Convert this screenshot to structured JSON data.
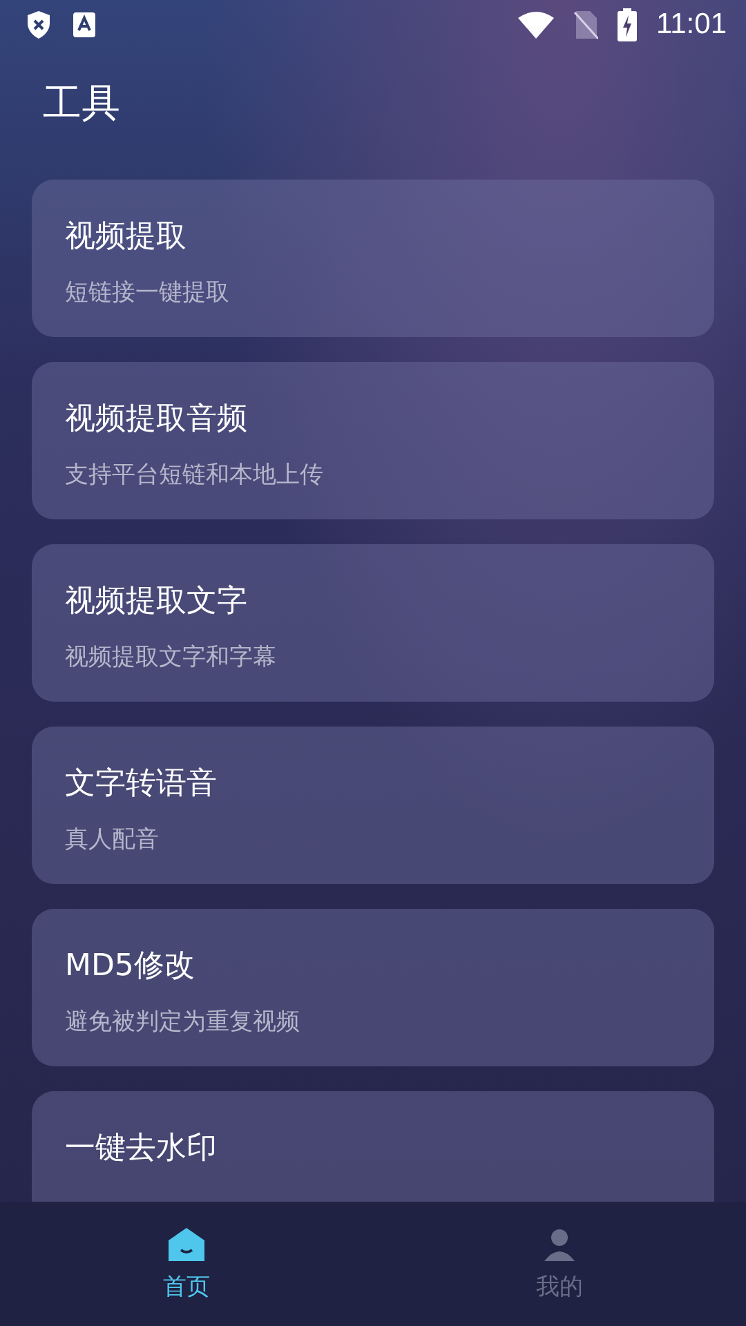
{
  "status_bar": {
    "time": "11:01"
  },
  "title": "工具",
  "tools": [
    {
      "name": "视频提取",
      "desc": "短链接一键提取"
    },
    {
      "name": "视频提取音频",
      "desc": "支持平台短链和本地上传"
    },
    {
      "name": "视频提取文字",
      "desc": "视频提取文字和字幕"
    },
    {
      "name": "文字转语音",
      "desc": "真人配音"
    },
    {
      "name": "MD5修改",
      "desc": "避免被判定为重复视频"
    },
    {
      "name": "一键去水印"
    }
  ],
  "nav": [
    {
      "label": "首页",
      "selected": true
    },
    {
      "label": "我的",
      "selected": false
    }
  ]
}
